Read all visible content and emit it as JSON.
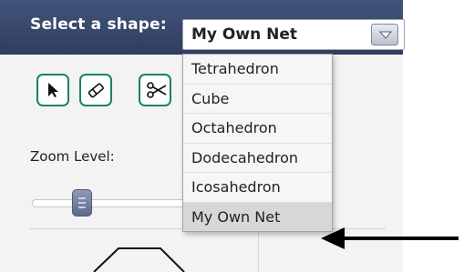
{
  "header": {
    "label": "Select a shape:"
  },
  "shape_select": {
    "value": "My Own Net",
    "options": [
      "Tetrahedron",
      "Cube",
      "Octahedron",
      "Dodecahedron",
      "Icosahedron",
      "My Own Net"
    ],
    "selected_index": 5
  },
  "toolbar": {
    "tools": [
      {
        "icon": "cursor-arrow-icon"
      },
      {
        "icon": "eraser-icon"
      },
      {
        "icon": "scissors-icon"
      }
    ]
  },
  "zoom": {
    "label": "Zoom Level:",
    "level": 0.3
  },
  "colors": {
    "header_bg": "#3a4b6e",
    "tool_border": "#17855b",
    "slider_thumb": "#6f7c9b",
    "selected_option_bg": "#d7d7d7"
  }
}
